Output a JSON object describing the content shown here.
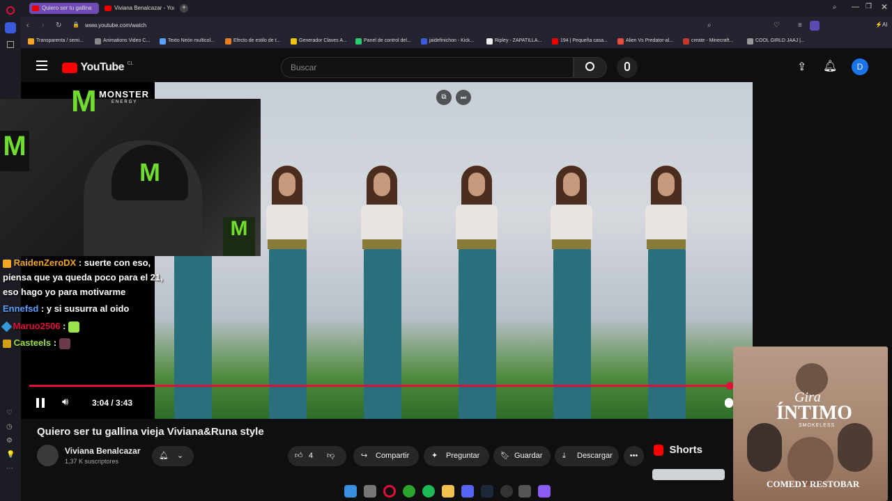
{
  "browser": {
    "tabs": [
      {
        "label": "Quiero ser tu gallina"
      },
      {
        "label": "Viviana Benalcazar - YouT"
      }
    ],
    "url": "www.youtube.com/watch",
    "ai_label": "AI",
    "bookmarks": [
      "Transparenta / semi...",
      "Animations Video C...",
      "Texto Neón multicol...",
      "Efecto de estilo de t...",
      "Generador Claves A...",
      "Panel de control del...",
      "jaidefinichon - Kick...",
      "Ripley - ZAPATILLA...",
      "194 | Pequeña casa...",
      "Alien Vs Predator-al...",
      "create - Minecraft...",
      "COOL GIRLD JAAJ |..."
    ]
  },
  "youtube": {
    "logo_text": "YouTube",
    "region": "CL",
    "search_placeholder": "Buscar",
    "avatar_letter": "D"
  },
  "player": {
    "time": "3:04 / 3:43",
    "progress": 0.824
  },
  "overlay": {
    "brand": "MONSTER",
    "brand_sub": "ENERGY",
    "chat": [
      {
        "user": "RaidenZeroDX",
        "text": ": suerte con eso,",
        "color": "#f5a623"
      },
      {
        "user": "",
        "text": "piensa que ya queda poco para el 21,",
        "color": "#ffffff"
      },
      {
        "user": "",
        "text": "eso hago yo para motivarme",
        "color": "#ffffff"
      },
      {
        "user": "Ennefsd",
        "text": ": y si susurra al oido",
        "color": "#5aa0ff"
      },
      {
        "user": "Maruo2506",
        "text": ":",
        "color": "#e0103a"
      },
      {
        "user": "Casteels",
        "text": ":",
        "color": "#9be34a"
      }
    ]
  },
  "video": {
    "title": "Quiero ser tu gallina vieja Viviana&Runa style",
    "channel": "Viviana Benalcazar",
    "subscribers": "1,37 K suscriptores",
    "likes": "4",
    "share_label": "Compartir",
    "ask_label": "Preguntar",
    "save_label": "Guardar",
    "download_label": "Descargar",
    "shorts_label": "Shorts"
  },
  "ad": {
    "line1": "Gira",
    "line2": "ÍNTIMO",
    "line3": "SMOKELESS",
    "footer": "COMEDY RESTOBAR"
  }
}
